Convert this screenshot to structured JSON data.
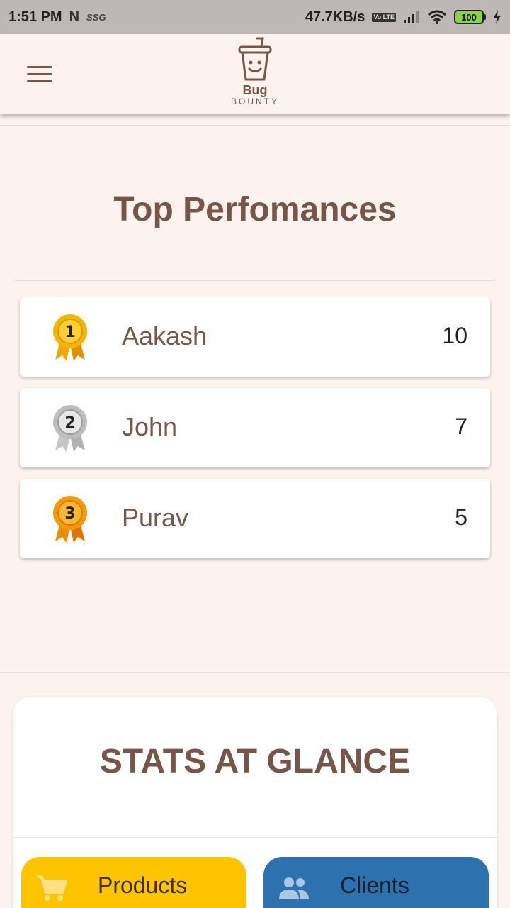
{
  "status_bar": {
    "time": "1:51 PM",
    "carrier_tag": "SSG",
    "network_speed": "47.7KB/s",
    "volte": "Vo LTE",
    "battery": "100"
  },
  "app_bar": {
    "logo_top": "Bug",
    "logo_bottom": "BOUNTY"
  },
  "top_performances": {
    "title": "Top Perfomances",
    "entries": [
      {
        "rank": "1",
        "name": "Aakash",
        "score": "10",
        "medal": "gold-medal-icon"
      },
      {
        "rank": "2",
        "name": "John",
        "score": "7",
        "medal": "silver-medal-icon"
      },
      {
        "rank": "3",
        "name": "Purav",
        "score": "5",
        "medal": "bronze-medal-icon"
      }
    ]
  },
  "stats": {
    "title": "STATS AT GLANCE",
    "buttons": [
      {
        "label": "Products",
        "icon": "cart-icon",
        "color": "#ffc400"
      },
      {
        "label": "Clients",
        "icon": "people-icon",
        "color": "#2d72ae"
      }
    ]
  },
  "colors": {
    "brand_brown": "#795548",
    "background": "#fcf3ef"
  }
}
